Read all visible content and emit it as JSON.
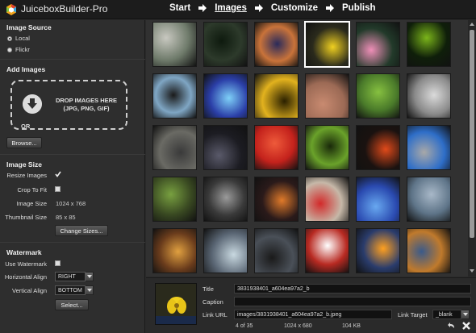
{
  "app": {
    "title": "JuiceboxBuilder-Pro"
  },
  "steps": [
    {
      "label": "Start",
      "active": false
    },
    {
      "label": "Images",
      "active": true
    },
    {
      "label": "Customize",
      "active": false
    },
    {
      "label": "Publish",
      "active": false
    }
  ],
  "image_source": {
    "title": "Image Source",
    "options": [
      {
        "label": "Local",
        "selected": true
      },
      {
        "label": "Flickr",
        "selected": false
      }
    ]
  },
  "add_images": {
    "title": "Add Images",
    "drop_text_line1": "DROP IMAGES HERE",
    "drop_text_line2": "(JPG, PNG, GIF)",
    "or_label": "OR",
    "browse_label": "Browse..."
  },
  "image_size": {
    "title": "Image Size",
    "resize_label": "Resize Images",
    "resize_checked": true,
    "crop_label": "Crop To Fit",
    "crop_checked": false,
    "image_size_label": "Image Size",
    "image_size_value": "1024 x 768",
    "thumb_size_label": "Thumbnail Size",
    "thumb_size_value": "85 x 85",
    "change_sizes_label": "Change Sizes..."
  },
  "watermark": {
    "title": "Watermark",
    "use_label": "Use Watermark",
    "use_checked": false,
    "h_align_label": "Horizontal Align",
    "h_align_value": "RIGHT",
    "v_align_label": "Vertical Align",
    "v_align_value": "BOTTOM",
    "select_label": "Select..."
  },
  "gallery": {
    "selected_index": 3,
    "thumb_count": 35,
    "thumb_colors": [
      [
        "#6e7a6a",
        "#2d3a2b",
        "#c9733a",
        "#2a2a1c",
        "#223a2a",
        "#0f1f0a"
      ],
      [
        "#7fa6c4",
        "#2b3fa8",
        "#e2b21e",
        "#9c6a55",
        "#4a7a2a",
        "#8a8a8a"
      ],
      [
        "#6a6a64",
        "#1c1c22",
        "#c4221c",
        "#6aa22a",
        "#1a1210",
        "#2e6ec8"
      ],
      [
        "#3a4a22",
        "#3a3a3a",
        "#2a1a1a",
        "#c6b8a8",
        "#2a4ab0",
        "#5e7488"
      ],
      [
        "#6a3c1c",
        "#5a6674",
        "#4a5058",
        "#b82a22",
        "#2a3c6c",
        "#c07a2c"
      ]
    ],
    "thumb_accents": [
      [
        "#c8c8c0",
        "#0e1a0e",
        "#2a2a5a",
        "#f0d020",
        "#ef8fb8",
        "#7ab41a"
      ],
      [
        "#1a1a1a",
        "#7ed0f8",
        "#2a2000",
        "#c88a70",
        "#86c040",
        "#dadada"
      ],
      [
        "#3a3a3a",
        "#5a5a6a",
        "#ee5a3a",
        "#1a2a0a",
        "#e04a1a",
        "#a8a8a8"
      ],
      [
        "#78a040",
        "#9a9a9a",
        "#e07a2a",
        "#d22a2a",
        "#68a8f0",
        "#a8b8c8"
      ],
      [
        "#e0a040",
        "#c8d8e0",
        "#1a1a1a",
        "#ffffff",
        "#ffa020",
        "#3a5a8a"
      ]
    ]
  },
  "detail": {
    "title_label": "Title",
    "title_value": "3831938401_a604ea97a2_b",
    "caption_label": "Caption",
    "caption_value": "",
    "link_url_label": "Link URL",
    "link_url_value": "images/3831938401_a604ea97a2_b.jpeg",
    "link_target_label": "Link Target",
    "link_target_value": "_blank",
    "index_text": "4 of 35",
    "dimensions_text": "1024 x 680",
    "filesize_text": "104 KB"
  }
}
